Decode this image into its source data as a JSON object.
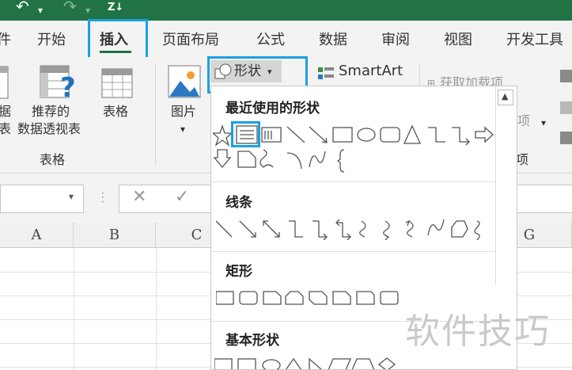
{
  "tabs": [
    {
      "label": "件"
    },
    {
      "label": "开始"
    },
    {
      "label": "插入"
    },
    {
      "label": "页面布局"
    },
    {
      "label": "公式"
    },
    {
      "label": "数据"
    },
    {
      "label": "审阅"
    },
    {
      "label": "视图"
    },
    {
      "label": "开发工具"
    }
  ],
  "quick_access": {
    "sort_label": "Z↓"
  },
  "ribbon": {
    "pivot_label_1": "据",
    "pivot_label_2": "表",
    "recommended_pivot_1": "推荐的",
    "recommended_pivot_2": "数据透视表",
    "table_label": "表格",
    "group_tables": "表格",
    "picture_label": "图片",
    "shapes_label": "形状",
    "smartart_label": "SmartArt",
    "addins_label": "获取加载项",
    "addins_group_fragment": "项",
    "addins_row2_fragment": "项"
  },
  "shapes_menu": {
    "recent": "最近使用的形状",
    "lines": "线条",
    "rectangles": "矩形",
    "basic": "基本形状"
  },
  "grid": {
    "columns": [
      "A",
      "B",
      "C",
      "G"
    ]
  },
  "watermark": "软件技巧",
  "colors": {
    "accent_green": "#217346",
    "highlight_blue": "#1ba1e2"
  }
}
